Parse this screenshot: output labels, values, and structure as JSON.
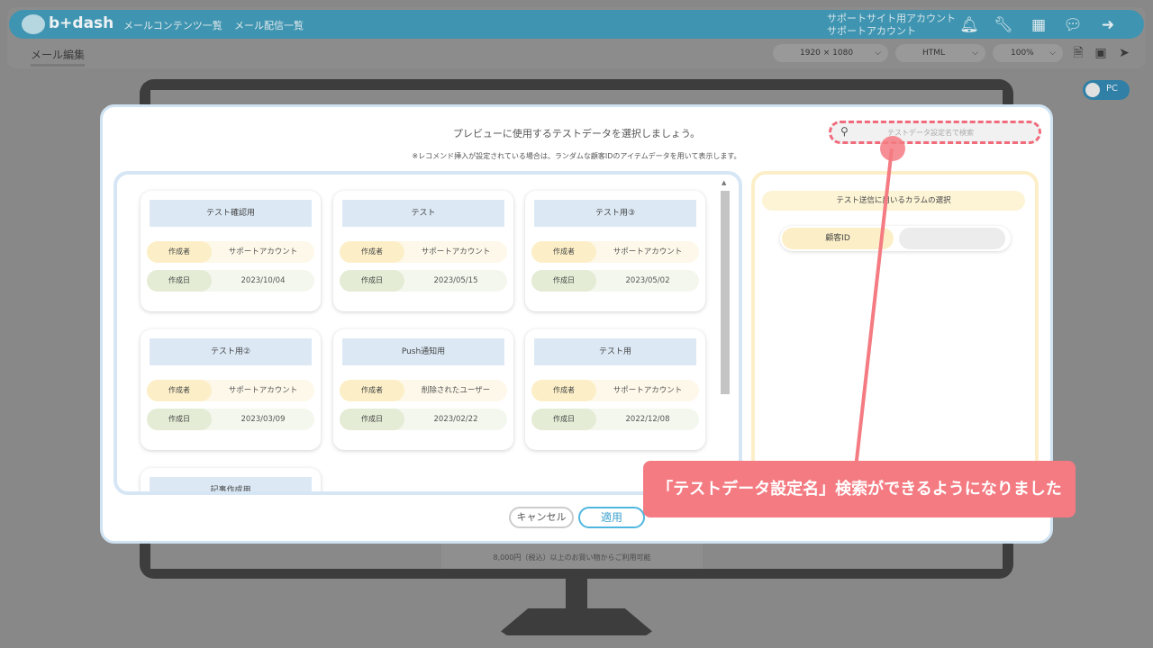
{
  "nav": {
    "logo_text": "b+dash",
    "links": [
      "メールコンテンツ一覧",
      "メール配信一覧"
    ],
    "account_line1": "サポートサイト用アカウント",
    "account_line2": "サポートアカウント"
  },
  "toolbar": {
    "title": "メール編集",
    "resolution": "1920 × 1080",
    "format": "HTML",
    "zoom": "100%"
  },
  "device_toggle": "PC",
  "background": {
    "footer_text": "8,000円（税込）以上のお買い物からご利用可能"
  },
  "modal": {
    "title": "プレビューに使用するテストデータを選択しましょう。",
    "note": "※レコメンド挿入が設定されている場合は、ランダムな顧客IDのアイテムデータを用いて表示します。",
    "search_placeholder": "テストデータ設定名で検索",
    "author_label": "作成者",
    "date_label": "作成日",
    "cards": [
      {
        "title": "テスト確認用",
        "author": "サポートアカウント",
        "date": "2023/10/04"
      },
      {
        "title": "テスト",
        "author": "サポートアカウント",
        "date": "2023/05/15"
      },
      {
        "title": "テスト用③",
        "author": "サポートアカウント",
        "date": "2023/05/02"
      },
      {
        "title": "テスト用②",
        "author": "サポートアカウント",
        "date": "2023/03/09"
      },
      {
        "title": "Push通知用",
        "author": "削除されたユーザー",
        "date": "2023/02/22"
      },
      {
        "title": "テスト用",
        "author": "サポートアカウント",
        "date": "2022/12/08"
      },
      {
        "title": "記事作成用",
        "author": "",
        "date": ""
      }
    ],
    "column_title": "テスト送信に用いるカラムの選択",
    "customer_id_label": "顧客ID",
    "customer_id_value": "",
    "cancel_label": "キャンセル",
    "apply_label": "適用"
  },
  "annotation": {
    "text": "「テストデータ設定名」検索ができるようになりました",
    "color": "#f47b82"
  }
}
